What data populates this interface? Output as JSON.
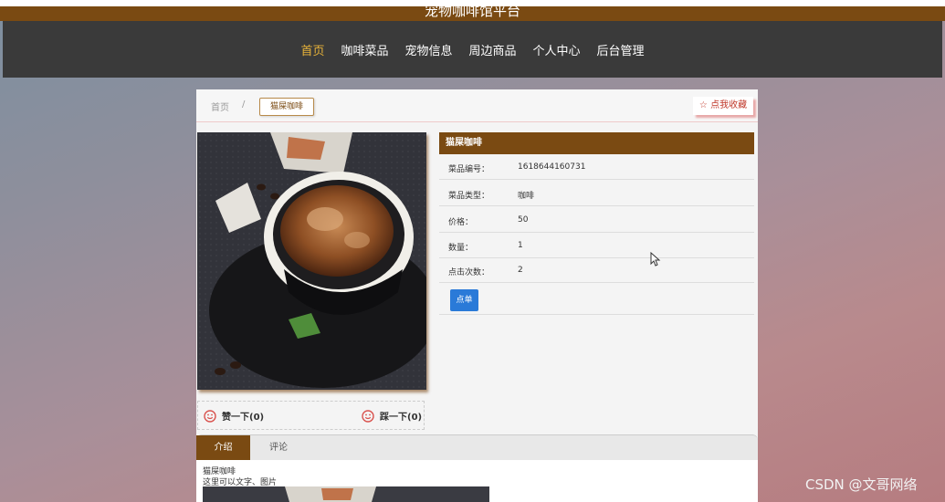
{
  "site": {
    "title": "宠物咖啡馆平台"
  },
  "nav": [
    {
      "label": "首页",
      "active": true
    },
    {
      "label": "咖啡菜品",
      "active": false
    },
    {
      "label": "宠物信息",
      "active": false
    },
    {
      "label": "周边商品",
      "active": false
    },
    {
      "label": "个人中心",
      "active": false
    },
    {
      "label": "后台管理",
      "active": false
    }
  ],
  "breadcrumb": {
    "home": "首页",
    "separator": "/",
    "current": "猫屎咖啡"
  },
  "favorite_button": "☆ 点我收藏",
  "product": {
    "header": "猫屎咖啡",
    "fields": [
      {
        "label": "菜品编号：",
        "value": "1618644160731"
      },
      {
        "label": "菜品类型：",
        "value": "咖啡"
      },
      {
        "label": "价格：",
        "value": "50"
      },
      {
        "label": "数量：",
        "value": "1"
      },
      {
        "label": "点击次数：",
        "value": "2"
      }
    ],
    "order_button": "点单"
  },
  "reactions": {
    "like": "赞一下(0)",
    "dislike": "踩一下(0)"
  },
  "tabs": {
    "intro": "介绍",
    "comments": "评论"
  },
  "intro": {
    "name": "猫屎咖啡",
    "text": "这里可以文字、图片"
  },
  "watermark": "CSDN @文哥网络",
  "colors": {
    "brand": "#7a4a12",
    "nav_bg": "#3a3a3a",
    "active_nav": "#e8b339",
    "button_blue": "#2a7ad8"
  }
}
